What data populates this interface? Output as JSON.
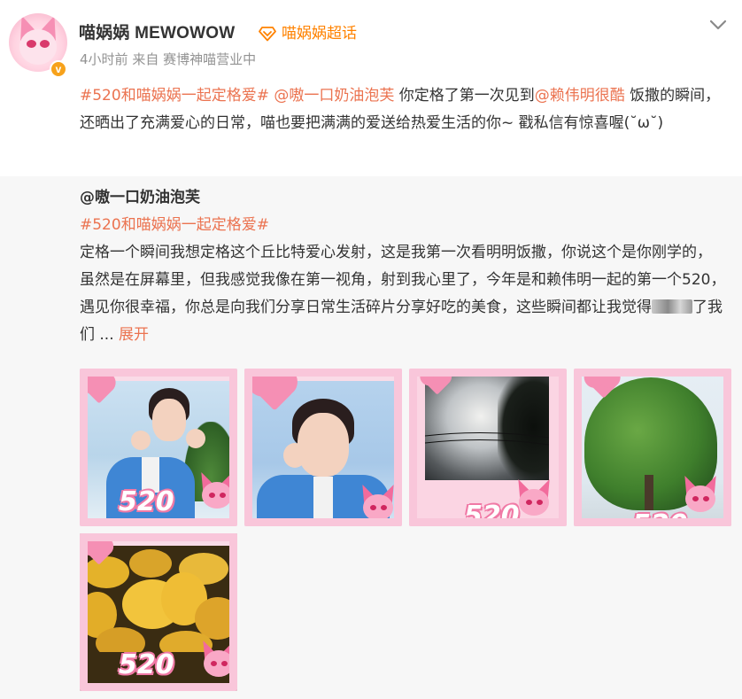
{
  "post": {
    "user_name": "喵娲娲 MEWOWOW",
    "supertopic_label": "喵娲娲超话",
    "time": "4小时前",
    "source": "来自 赛博神喵营业中",
    "verify_badge": "v",
    "text_hashtag": "#520和喵娲娲一起定格爱#",
    "text_mention1": "@嗷一口奶油泡芙",
    "text_part1": " 你定格了第一次见到",
    "text_mention2": "@赖伟明很酷",
    "text_part2": " 饭撒的瞬间，还晒出了充满爱心的日常，喵也要把满满的爱送给热爱生活的你~ 戳私信有惊喜喔(˘ω˘)"
  },
  "repost": {
    "author": "@嗷一口奶油泡芙",
    "hashtag": "#520和喵娲娲一起定格爱#",
    "text_before": "定格一个瞬间我想定格这个丘比特爱心发射，这是我第一次看明明饭撒，你说这个是你刚学的，虽然是在屏幕里，但我感觉我像在第一视角，射到我心里了，今年是和赖伟明一起的第一个520，遇见你很幸福，你总是向我们分享日常生活碎片分享好吃的美食，这些瞬间都让我觉得",
    "text_after": "了我们 ...",
    "expand_label": "展开"
  },
  "photos": [
    {
      "name": "photo-person-heart-hands",
      "badge": "520"
    },
    {
      "name": "photo-person-closeup",
      "badge": ""
    },
    {
      "name": "photo-sky-wires",
      "badge": "520"
    },
    {
      "name": "photo-green-tree",
      "badge": "520"
    },
    {
      "name": "photo-mangoes",
      "badge": "520"
    }
  ],
  "icons": {
    "supertopic": "diamond-icon",
    "more": "chevron-down-icon"
  },
  "colors": {
    "link": "#eb7350",
    "supertopic": "#ff8200",
    "meta": "#939393",
    "repost_bg": "#f7f7f7",
    "frame_pink": "#f9c6da"
  }
}
